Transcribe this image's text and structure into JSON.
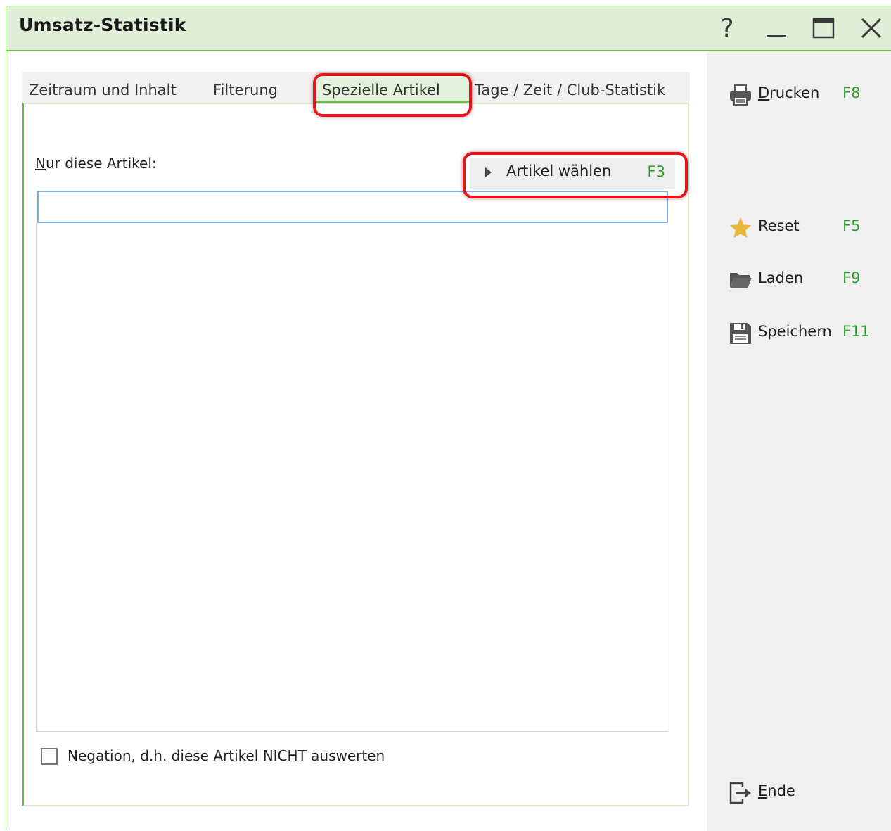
{
  "window": {
    "title": "Umsatz-Statistik",
    "help_glyph": "?",
    "controls": [
      "help-icon",
      "minimize-icon",
      "maximize-icon",
      "close-icon"
    ]
  },
  "tabs": [
    {
      "label": "Zeitraum und Inhalt",
      "active": false
    },
    {
      "label": "Filterung",
      "active": false
    },
    {
      "label": "Spezielle Artikel",
      "active": true
    },
    {
      "label": "Tage / Zeit / Club-Statistik",
      "active": false
    }
  ],
  "panel": {
    "label_nur_first": "N",
    "label_nur_rest": "ur diese Artikel:",
    "artikel_button": {
      "label": "Artikel wählen",
      "key": "F3",
      "icon": "play-arrow-icon"
    },
    "search_value": "",
    "checkbox": {
      "label": "Negation, d.h. diese Artikel NICHT auswerten",
      "checked": false
    }
  },
  "sidebar": {
    "drucken": {
      "label_first": "D",
      "label_rest": "rucken",
      "key": "F8",
      "icon": "printer-icon"
    },
    "reset": {
      "label": "Reset",
      "key": "F5",
      "icon": "star-icon"
    },
    "laden": {
      "label": "Laden",
      "key": "F9",
      "icon": "folder-open-icon"
    },
    "speichern": {
      "label": "Speichern",
      "key": "F11",
      "icon": "floppy-disk-icon"
    },
    "ende": {
      "label_first": "E",
      "label_rest": "nde",
      "icon": "exit-icon"
    }
  },
  "colors": {
    "accent_green": "#6cb84e",
    "titlebar_bg": "#e0eed8",
    "shortcut_green": "#2a9d2a",
    "highlight_red": "#e4161c",
    "star_yellow": "#e8b73a"
  }
}
